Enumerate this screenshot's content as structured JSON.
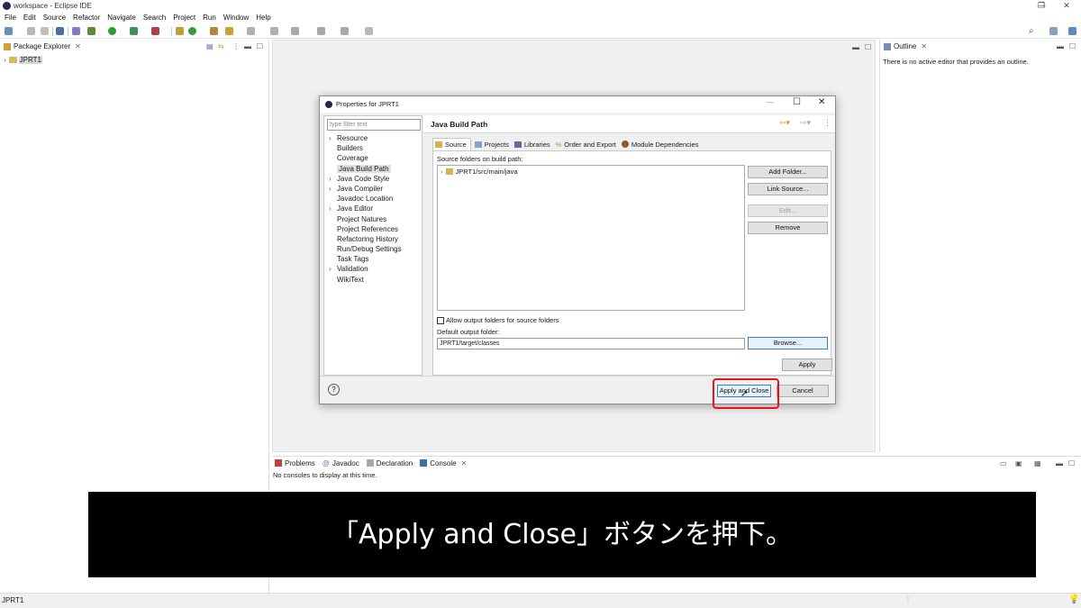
{
  "window": {
    "title": "workspace - Eclipse IDE",
    "controls": [
      "—",
      "❐",
      "✕"
    ]
  },
  "menu": [
    "File",
    "Edit",
    "Source",
    "Refactor",
    "Navigate",
    "Search",
    "Project",
    "Run",
    "Window",
    "Help"
  ],
  "package_explorer": {
    "tab_label": "Package Explorer",
    "project": "JPRT1"
  },
  "outline": {
    "tab_label": "Outline",
    "message": "There is no active editor that provides an outline."
  },
  "console": {
    "tabs": [
      "Problems",
      "Javadoc",
      "Declaration",
      "Console"
    ],
    "message": "No consoles to display at this time."
  },
  "status_bar": {
    "text": "JPRT1"
  },
  "dialog": {
    "title": "Properties for JPRT1",
    "filter_placeholder": "type filter text",
    "nav": [
      {
        "label": "Resource",
        "expandable": true
      },
      {
        "label": "Builders",
        "expandable": false
      },
      {
        "label": "Coverage",
        "expandable": false
      },
      {
        "label": "Java Build Path",
        "expandable": false,
        "selected": true
      },
      {
        "label": "Java Code Style",
        "expandable": true
      },
      {
        "label": "Java Compiler",
        "expandable": true
      },
      {
        "label": "Javadoc Location",
        "expandable": false
      },
      {
        "label": "Java Editor",
        "expandable": true
      },
      {
        "label": "Project Natures",
        "expandable": false
      },
      {
        "label": "Project References",
        "expandable": false
      },
      {
        "label": "Refactoring History",
        "expandable": false
      },
      {
        "label": "Run/Debug Settings",
        "expandable": false
      },
      {
        "label": "Task Tags",
        "expandable": false
      },
      {
        "label": "Validation",
        "expandable": true
      },
      {
        "label": "WikiText",
        "expandable": false
      }
    ],
    "page_title": "Java Build Path",
    "tabs": {
      "source": "Source",
      "projects": "Projects",
      "libraries": "Libraries",
      "order": "Order and Export",
      "modules": "Module Dependencies"
    },
    "source_folders_label": "Source folders on build path:",
    "source_folder": "JPRT1/src/main/java",
    "side_buttons": {
      "add_folder": "Add Folder...",
      "link_source": "Link Source...",
      "edit": "Edit...",
      "remove": "Remove"
    },
    "allow_output_label": "Allow output folders for source folders",
    "default_output_label": "Default output folder:",
    "default_output_value": "JPRT1/target/classes",
    "browse": "Browse...",
    "apply": "Apply",
    "apply_and_close": "Apply and Close",
    "cancel": "Cancel",
    "help": "?"
  },
  "caption": "「Apply and Close」ボタンを押下。",
  "colors": {
    "highlight": "#e8131c",
    "caption_bg": "#000000",
    "selection": "#e0e0e0"
  }
}
